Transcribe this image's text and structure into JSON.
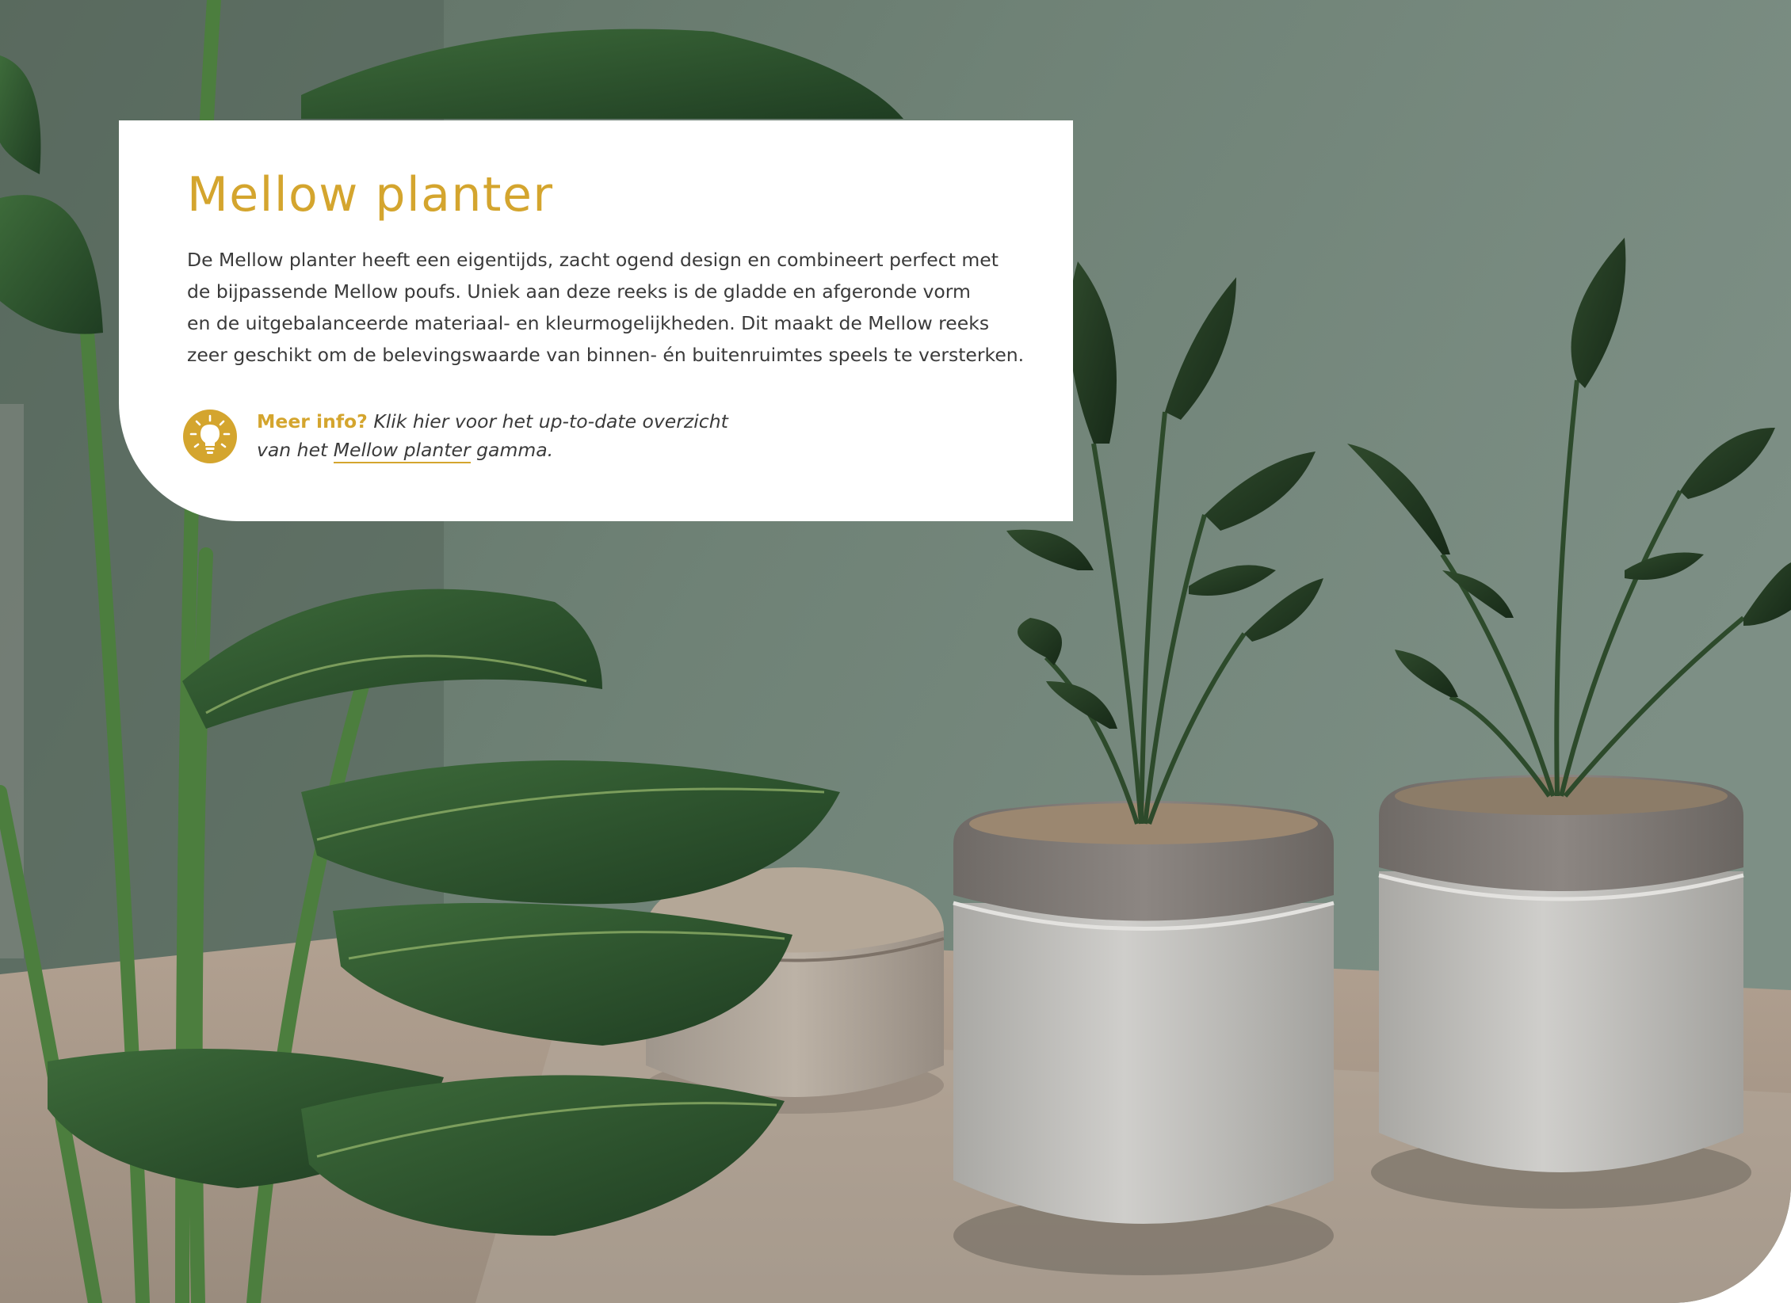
{
  "card": {
    "title": "Mellow planter",
    "body_lines": [
      "De Mellow planter heeft een eigentijds, zacht ogend design en combineert perfect met",
      "de bijpassende Mellow poufs. Uniek aan deze reeks is de gladde en afgeronde vorm",
      "en de uitgebalanceerde materiaal- en kleurmogelijkheden. Dit maakt de Mellow reeks",
      "zeer geschikt om de belevingswaarde van binnen- én buitenruimtes speels te versterken."
    ],
    "info": {
      "icon": "lightbulb-icon",
      "lead": "Meer info?",
      "line1": "Klik hier voor het up-to-date overzicht",
      "line2_prefix": "van het ",
      "link_text": "Mellow planter",
      "line2_suffix": " gamma."
    }
  },
  "colors": {
    "accent": "#d4a52e",
    "text": "#3a3a3a",
    "wall": "#6f8276",
    "floor": "#a8998a"
  }
}
